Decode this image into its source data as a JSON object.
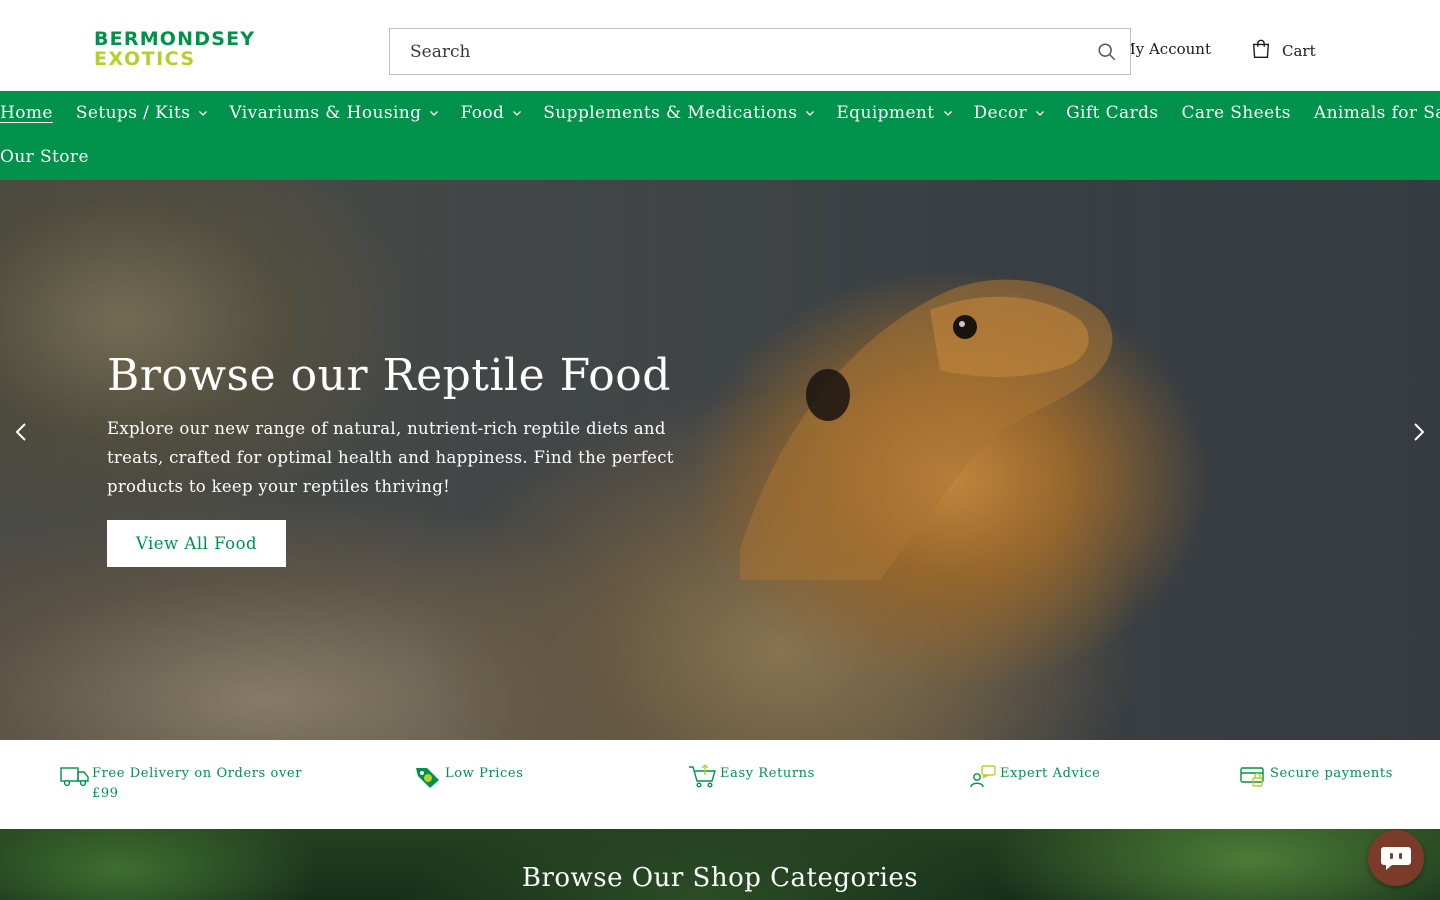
{
  "brand": {
    "logo_line1": "BERMONDSEY",
    "logo_line2": "EXOTICS",
    "primary_color": "#00924a",
    "secondary_color": "#b6cf2a"
  },
  "header": {
    "search_placeholder": "Search",
    "search_icon": "search-icon",
    "account_label": "My Account",
    "cart_label": "Cart",
    "cart_icon": "shopping-bag-icon"
  },
  "nav": {
    "row1": [
      {
        "label": "Home",
        "active": true,
        "has_dropdown": false
      },
      {
        "label": "Setups / Kits",
        "has_dropdown": true
      },
      {
        "label": "Vivariums & Housing",
        "has_dropdown": true
      },
      {
        "label": "Food",
        "has_dropdown": true
      },
      {
        "label": "Supplements & Medications",
        "has_dropdown": true
      },
      {
        "label": "Equipment",
        "has_dropdown": true
      },
      {
        "label": "Decor",
        "has_dropdown": true
      },
      {
        "label": "Gift Cards",
        "has_dropdown": false
      },
      {
        "label": "Care Sheets",
        "has_dropdown": false
      },
      {
        "label": "Animals for Sale",
        "has_dropdown": false
      }
    ],
    "row2": [
      {
        "label": "Our Store",
        "has_dropdown": false
      }
    ]
  },
  "hero": {
    "title": "Browse our Reptile Food",
    "text": "Explore our new range of natural, nutrient-rich reptile diets and treats, crafted for optimal health and happiness. Find the perfect products to keep your reptiles thriving!",
    "button_label": "View All Food",
    "prev_icon": "chevron-left-icon",
    "next_icon": "chevron-right-icon"
  },
  "benefits": [
    {
      "label": "Free Delivery on Orders over £99",
      "icon": "delivery-truck-icon"
    },
    {
      "label": "Low Prices",
      "icon": "price-tag-icon"
    },
    {
      "label": "Easy Returns",
      "icon": "returns-cart-icon"
    },
    {
      "label": "Expert Advice",
      "icon": "expert-advice-icon"
    },
    {
      "label": "Secure payments",
      "icon": "secure-payment-icon"
    }
  ],
  "categories": {
    "title": "Browse Our Shop Categories"
  },
  "chat": {
    "icon": "chat-icon"
  }
}
